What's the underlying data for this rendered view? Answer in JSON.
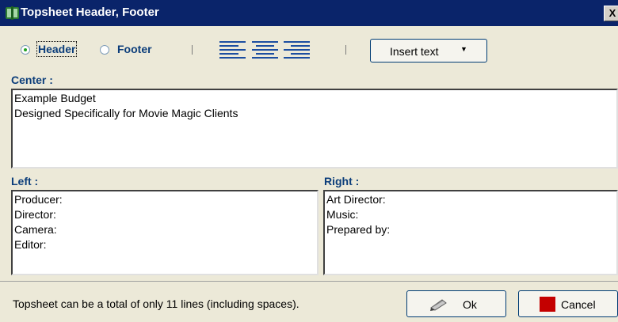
{
  "window": {
    "title": "Topsheet Header, Footer",
    "close_label": "X",
    "icon": "film-app-icon"
  },
  "toolbar": {
    "header_label": "Header",
    "footer_label": "Footer",
    "selected": "Header",
    "align_icons": [
      "align-left-icon",
      "align-center-icon",
      "align-right-icon"
    ],
    "insert_label": "Insert text"
  },
  "center": {
    "label": "Center :",
    "lines": [
      "Example Budget",
      "Designed Specifically for Movie Magic Clients"
    ]
  },
  "left": {
    "label": "Left :",
    "lines": [
      "Producer:",
      "Director:",
      "Camera:",
      "Editor:"
    ]
  },
  "right": {
    "label": "Right :",
    "lines": [
      "Art Director:",
      "Music:",
      "Prepared by:"
    ]
  },
  "footer": {
    "status": "Topsheet can be a total of only 11 lines (including spaces).",
    "ok_label": "Ok",
    "cancel_label": "Cancel"
  },
  "colors": {
    "title_bar": "#0a246a",
    "label_blue": "#0b3d7a",
    "align_icon": "#1c4ea1",
    "cancel_square": "#c40000",
    "radio_dot": "#21a121"
  }
}
